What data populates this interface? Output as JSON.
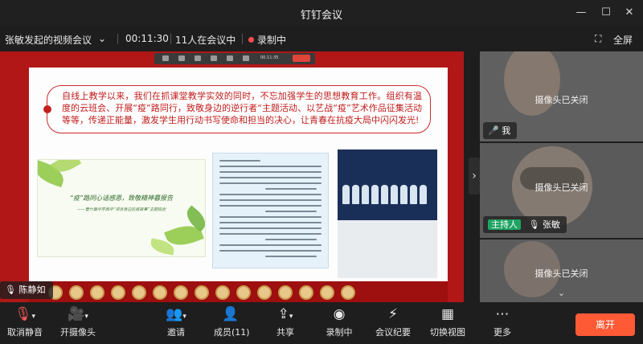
{
  "window": {
    "title": "钉钉会议",
    "controls": [
      "minimize-icon",
      "maximize-icon",
      "close-icon"
    ]
  },
  "meeting": {
    "name": "张敏发起的视频会议",
    "elapsed": "00:11:30",
    "attendees": "11人在会议中",
    "recording": "录制中",
    "fullscreen": "全屏"
  },
  "shared_screen": {
    "mini_toolbar_time": "00:11:35",
    "slide_text": "自线上教学以来，我们在抓课堂教学实效的同时，不忘加强学生的思想教育工作。组织有温度的云班会、开展“疫”路同行，致敬身边的逆行者“主题活动、以艺战“疫”艺术作品征集活动等等，传递正能量，激发学生用行动书写使命和担当的决心，让青春在抗疫大局中闪闪发光!",
    "poster_left_title": "“疫”路同心话感恩，致敬精神暮报告",
    "poster_left_subtitle": "——营什面中学高中“讲诉身边抗疫故事”主题班会",
    "speaker": "陈静如"
  },
  "participants": [
    {
      "camera_status": "摄像头已关闭",
      "name": "我",
      "host": "",
      "mic": "muted"
    },
    {
      "camera_status": "摄像头已关闭",
      "name": "张敏",
      "host": "主持人",
      "mic": "on"
    },
    {
      "camera_status": "摄像头已关闭",
      "name": "",
      "host": "",
      "mic": ""
    }
  ],
  "toolbar": {
    "mute": "取消静音",
    "camera": "开摄像头",
    "invite": "邀请",
    "members": "成员(11)",
    "share": "共享",
    "recording": "录制中",
    "minutes": "会议纪要",
    "switch_view": "切换视图",
    "more": "更多",
    "leave": "离开"
  },
  "colors": {
    "leave_button": "#ff5a36",
    "host_badge": "#1fa463",
    "recording_dot": "#ff4d4f"
  }
}
